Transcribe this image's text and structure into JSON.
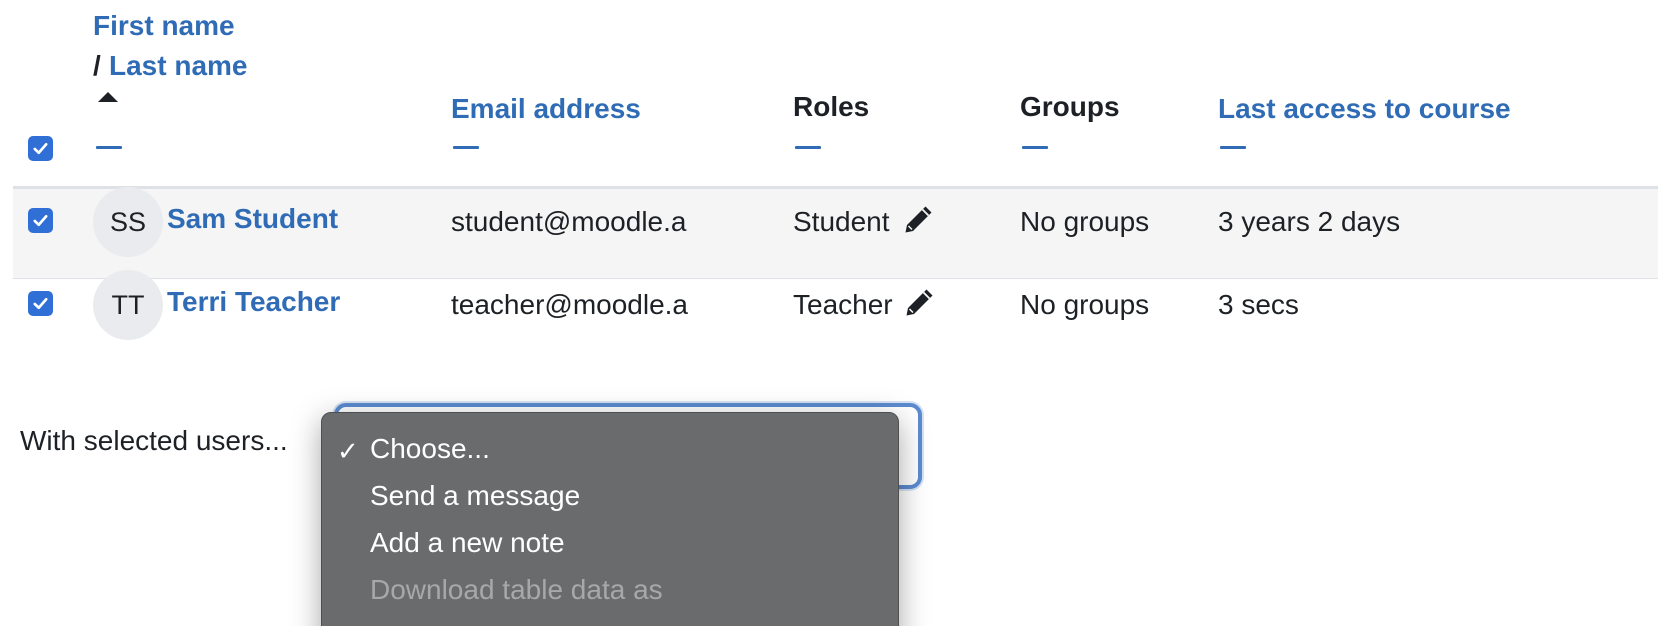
{
  "table": {
    "headers": {
      "name_first": "First name",
      "name_separator": "/",
      "name_last": "Last name",
      "email": "Email address",
      "roles": "Roles",
      "groups": "Groups",
      "last_access": "Last access to course"
    },
    "rows": [
      {
        "initials": "SS",
        "name": "Sam Student",
        "email": "student@moodle.a",
        "role": "Student",
        "groups": "No groups",
        "last_access": "3 years 2 days",
        "selected": true
      },
      {
        "initials": "TT",
        "name": "Terri Teacher",
        "email": "teacher@moodle.a",
        "role": "Teacher",
        "groups": "No groups",
        "last_access": "3 secs",
        "selected": true
      }
    ]
  },
  "bulk_actions": {
    "label": "With selected users...",
    "options": [
      {
        "label": "Choose...",
        "selected": true,
        "disabled": false
      },
      {
        "label": "Send a message",
        "selected": false,
        "disabled": false
      },
      {
        "label": "Add a new note",
        "selected": false,
        "disabled": false
      },
      {
        "label": "Download table data as",
        "selected": false,
        "disabled": true
      }
    ],
    "check_glyph": "✓"
  },
  "icons": {
    "checkbox": "check-icon",
    "sort": "sort-ascending-icon",
    "edit": "pencil-icon"
  },
  "colors": {
    "link": "#2f6cb5",
    "checkbox": "#2f6fd6",
    "menu_bg": "#6a6b6d",
    "row_highlight": "#f5f5f6"
  }
}
